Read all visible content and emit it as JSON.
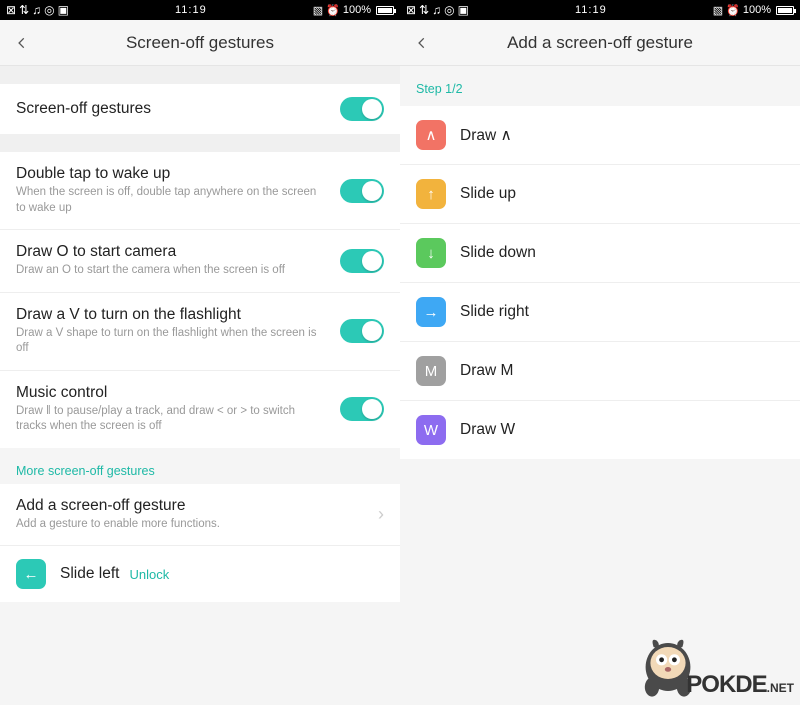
{
  "status": {
    "time": "11:19",
    "battery": "100%"
  },
  "left": {
    "title": "Screen-off gestures",
    "main_toggle": {
      "label": "Screen-off gestures"
    },
    "items": [
      {
        "label": "Double tap to wake up",
        "sub": "When the screen is off, double tap anywhere on the screen to wake up"
      },
      {
        "label": "Draw O to start camera",
        "sub": "Draw an O to start the camera when the screen is off"
      },
      {
        "label": "Draw a V to turn on the flashlight",
        "sub": "Draw a V shape to turn on the flashlight when the screen is off"
      },
      {
        "label": "Music control",
        "sub": "Draw ‖ to pause/play a track, and draw  <  or  >  to switch tracks when the screen is off"
      }
    ],
    "more_section": "More screen-off gestures",
    "add": {
      "label": "Add a screen-off gesture",
      "sub": "Add a gesture to enable more functions."
    },
    "slide_left": {
      "label": "Slide left",
      "action": "Unlock"
    }
  },
  "right": {
    "title": "Add a screen-off gesture",
    "step": "Step 1/2",
    "options": [
      {
        "label": "Draw ∧",
        "color": "coral",
        "glyph": "∧"
      },
      {
        "label": "Slide up",
        "color": "gold",
        "glyph": "↑"
      },
      {
        "label": "Slide down",
        "color": "green",
        "glyph": "↓"
      },
      {
        "label": "Slide right",
        "color": "blue",
        "glyph": "→"
      },
      {
        "label": "Draw M",
        "color": "gray",
        "glyph": "M"
      },
      {
        "label": "Draw W",
        "color": "purple",
        "glyph": "W"
      }
    ]
  },
  "watermark": {
    "brand": "POKDE",
    "suffix": ".NET"
  }
}
